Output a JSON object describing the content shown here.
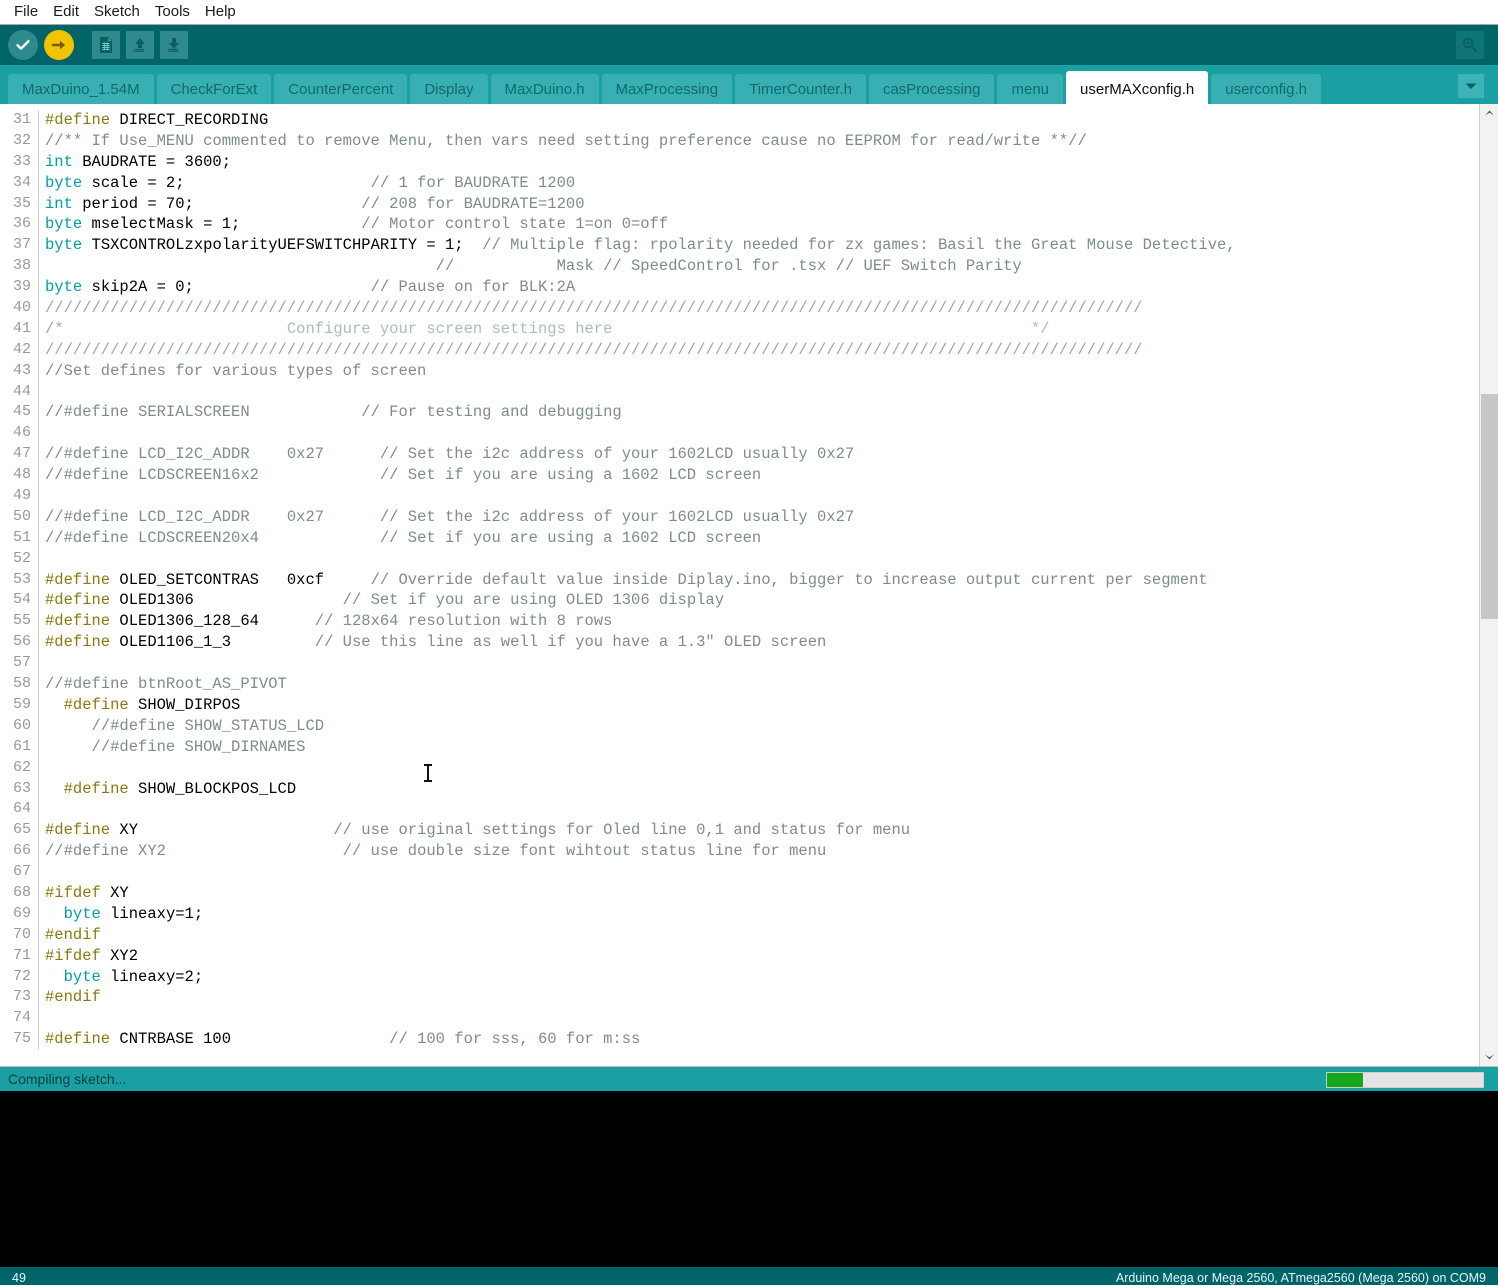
{
  "menubar": {
    "items": [
      "File",
      "Edit",
      "Sketch",
      "Tools",
      "Help"
    ]
  },
  "toolbar": {
    "verify_label": "Verify",
    "upload_label": "Upload",
    "new_label": "New",
    "open_label": "Open",
    "save_label": "Save",
    "serial_monitor_label": "Serial Monitor",
    "colors": {
      "bar": "#006468",
      "verify_bg": "#2f8a8e",
      "upload_bg": "#f2c400"
    }
  },
  "tabs": {
    "items": [
      {
        "label": "MaxDuino_1.54M",
        "active": false
      },
      {
        "label": "CheckForExt",
        "active": false
      },
      {
        "label": "CounterPercent",
        "active": false
      },
      {
        "label": "Display",
        "active": false
      },
      {
        "label": "MaxDuino.h",
        "active": false
      },
      {
        "label": "MaxProcessing",
        "active": false
      },
      {
        "label": "TimerCounter.h",
        "active": false
      },
      {
        "label": "casProcessing",
        "active": false
      },
      {
        "label": "menu",
        "active": false
      },
      {
        "label": "userMAXconfig.h",
        "active": true
      },
      {
        "label": "userconfig.h",
        "active": false
      }
    ],
    "dropdown_icon": "chevron-down-icon",
    "bar_color": "#1a9fa3",
    "tab_color": "#38b0b3"
  },
  "editor": {
    "first_line": 31,
    "lines": [
      {
        "n": 31,
        "parts": [
          {
            "t": "#define ",
            "c": "k-pre"
          },
          {
            "t": "DIRECT_RECORDING",
            "c": ""
          }
        ]
      },
      {
        "n": 32,
        "parts": [
          {
            "t": "//** If Use_MENU commented to remove Menu, then vars need setting preference cause no EEPROM for read/write **//",
            "c": "k-cmt"
          }
        ]
      },
      {
        "n": 33,
        "parts": [
          {
            "t": "int",
            "c": "k-type"
          },
          {
            "t": " BAUDRATE = 3600;",
            "c": ""
          }
        ]
      },
      {
        "n": 34,
        "parts": [
          {
            "t": "byte",
            "c": "k-type"
          },
          {
            "t": " scale = 2;                    ",
            "c": ""
          },
          {
            "t": "// 1 for BAUDRATE 1200",
            "c": "k-cmt"
          }
        ]
      },
      {
        "n": 35,
        "parts": [
          {
            "t": "int",
            "c": "k-type"
          },
          {
            "t": " period = 70;                  ",
            "c": ""
          },
          {
            "t": "// 208 for BAUDRATE=1200",
            "c": "k-cmt"
          }
        ]
      },
      {
        "n": 36,
        "parts": [
          {
            "t": "byte",
            "c": "k-type"
          },
          {
            "t": " mselectMask = 1;             ",
            "c": ""
          },
          {
            "t": "// Motor control state 1=on 0=off",
            "c": "k-cmt"
          }
        ]
      },
      {
        "n": 37,
        "parts": [
          {
            "t": "byte",
            "c": "k-type"
          },
          {
            "t": " TSXCONTROLzxpolarityUEFSWITCHPARITY = 1;  ",
            "c": ""
          },
          {
            "t": "// Multiple flag: rpolarity needed for zx games: Basil the Great Mouse Detective,",
            "c": "k-cmt"
          }
        ]
      },
      {
        "n": 38,
        "parts": [
          {
            "t": "                                          ",
            "c": ""
          },
          {
            "t": "//           Mask // SpeedControl for .tsx // UEF Switch Parity",
            "c": "k-cmt"
          }
        ]
      },
      {
        "n": 39,
        "parts": [
          {
            "t": "byte",
            "c": "k-type"
          },
          {
            "t": " skip2A = 0;                   ",
            "c": ""
          },
          {
            "t": "// Pause on for BLK:2A",
            "c": "k-cmt"
          }
        ]
      },
      {
        "n": 40,
        "parts": [
          {
            "t": "//////////////////////////////////////////////////////////////////////////////////////////////////////////////////////",
            "c": "k-cmt-l"
          }
        ]
      },
      {
        "n": 41,
        "parts": [
          {
            "t": "/*",
            "c": "k-cmt-l"
          },
          {
            "t": "                        Configure your screen settings here                                             ",
            "c": "k-cmt-g"
          },
          {
            "t": "*/",
            "c": "k-cmt-g"
          }
        ]
      },
      {
        "n": 42,
        "parts": [
          {
            "t": "//////////////////////////////////////////////////////////////////////////////////////////////////////////////////////",
            "c": "k-cmt-l"
          }
        ]
      },
      {
        "n": 43,
        "parts": [
          {
            "t": "//Set defines for various types of screen",
            "c": "k-cmt"
          }
        ]
      },
      {
        "n": 44,
        "parts": [
          {
            "t": "",
            "c": ""
          }
        ]
      },
      {
        "n": 45,
        "parts": [
          {
            "t": "//#define SERIALSCREEN            ",
            "c": "k-cmt"
          },
          {
            "t": "// For testing and debugging",
            "c": "k-cmt"
          }
        ]
      },
      {
        "n": 46,
        "parts": [
          {
            "t": "",
            "c": ""
          }
        ]
      },
      {
        "n": 47,
        "parts": [
          {
            "t": "//#define LCD_I2C_ADDR    0x27      ",
            "c": "k-cmt"
          },
          {
            "t": "// Set the i2c address of your 1602LCD usually 0x27",
            "c": "k-cmt"
          }
        ]
      },
      {
        "n": 48,
        "parts": [
          {
            "t": "//#define LCDSCREEN16x2             ",
            "c": "k-cmt"
          },
          {
            "t": "// Set if you are using a 1602 LCD screen",
            "c": "k-cmt"
          }
        ]
      },
      {
        "n": 49,
        "parts": [
          {
            "t": "",
            "c": ""
          }
        ]
      },
      {
        "n": 50,
        "parts": [
          {
            "t": "//#define LCD_I2C_ADDR    0x27      ",
            "c": "k-cmt"
          },
          {
            "t": "// Set the i2c address of your 1602LCD usually 0x27",
            "c": "k-cmt"
          }
        ]
      },
      {
        "n": 51,
        "parts": [
          {
            "t": "//#define LCDSCREEN20x4             ",
            "c": "k-cmt"
          },
          {
            "t": "// Set if you are using a 1602 LCD screen",
            "c": "k-cmt"
          }
        ]
      },
      {
        "n": 52,
        "parts": [
          {
            "t": "",
            "c": ""
          }
        ]
      },
      {
        "n": 53,
        "parts": [
          {
            "t": "#define ",
            "c": "k-pre"
          },
          {
            "t": "OLED_SETCONTRAS   0xcf     ",
            "c": ""
          },
          {
            "t": "// Override default value inside Diplay.ino, bigger to increase output current per segment",
            "c": "k-cmt"
          }
        ]
      },
      {
        "n": 54,
        "parts": [
          {
            "t": "#define ",
            "c": "k-pre"
          },
          {
            "t": "OLED1306                ",
            "c": ""
          },
          {
            "t": "// Set if you are using OLED 1306 display",
            "c": "k-cmt"
          }
        ]
      },
      {
        "n": 55,
        "parts": [
          {
            "t": "#define ",
            "c": "k-pre"
          },
          {
            "t": "OLED1306_128_64      ",
            "c": ""
          },
          {
            "t": "// 128x64 resolution with 8 rows",
            "c": "k-cmt"
          }
        ]
      },
      {
        "n": 56,
        "parts": [
          {
            "t": "#define ",
            "c": "k-pre"
          },
          {
            "t": "OLED1106_1_3         ",
            "c": ""
          },
          {
            "t": "// Use this line as well if you have a 1.3\" OLED screen",
            "c": "k-cmt"
          }
        ]
      },
      {
        "n": 57,
        "parts": [
          {
            "t": "",
            "c": ""
          }
        ]
      },
      {
        "n": 58,
        "parts": [
          {
            "t": "//#define btnRoot_AS_PIVOT",
            "c": "k-cmt"
          }
        ]
      },
      {
        "n": 59,
        "parts": [
          {
            "t": "  ",
            "c": ""
          },
          {
            "t": "#define ",
            "c": "k-pre"
          },
          {
            "t": "SHOW_DIRPOS",
            "c": ""
          }
        ]
      },
      {
        "n": 60,
        "parts": [
          {
            "t": "     ",
            "c": ""
          },
          {
            "t": "//#define SHOW_STATUS_LCD",
            "c": "k-cmt"
          }
        ]
      },
      {
        "n": 61,
        "parts": [
          {
            "t": "     ",
            "c": ""
          },
          {
            "t": "//#define SHOW_DIRNAMES",
            "c": "k-cmt"
          }
        ]
      },
      {
        "n": 62,
        "parts": [
          {
            "t": "",
            "c": ""
          }
        ]
      },
      {
        "n": 63,
        "parts": [
          {
            "t": "  ",
            "c": ""
          },
          {
            "t": "#define ",
            "c": "k-pre"
          },
          {
            "t": "SHOW_BLOCKPOS_LCD",
            "c": ""
          }
        ]
      },
      {
        "n": 64,
        "parts": [
          {
            "t": "",
            "c": ""
          }
        ]
      },
      {
        "n": 65,
        "parts": [
          {
            "t": "#define ",
            "c": "k-pre"
          },
          {
            "t": "XY                     ",
            "c": ""
          },
          {
            "t": "// use original settings for Oled line 0,1 and status for menu",
            "c": "k-cmt"
          }
        ]
      },
      {
        "n": 66,
        "parts": [
          {
            "t": "//#define XY2                   ",
            "c": "k-cmt"
          },
          {
            "t": "// use double size font wihtout status line for menu",
            "c": "k-cmt"
          }
        ]
      },
      {
        "n": 67,
        "parts": [
          {
            "t": "",
            "c": ""
          }
        ]
      },
      {
        "n": 68,
        "parts": [
          {
            "t": "#ifdef ",
            "c": "k-pre"
          },
          {
            "t": "XY",
            "c": ""
          }
        ]
      },
      {
        "n": 69,
        "parts": [
          {
            "t": "  ",
            "c": ""
          },
          {
            "t": "byte",
            "c": "k-type"
          },
          {
            "t": " lineaxy=1;",
            "c": ""
          }
        ]
      },
      {
        "n": 70,
        "parts": [
          {
            "t": "#endif",
            "c": "k-pre"
          }
        ]
      },
      {
        "n": 71,
        "parts": [
          {
            "t": "#ifdef ",
            "c": "k-pre"
          },
          {
            "t": "XY2",
            "c": ""
          }
        ]
      },
      {
        "n": 72,
        "parts": [
          {
            "t": "  ",
            "c": ""
          },
          {
            "t": "byte",
            "c": "k-type"
          },
          {
            "t": " lineaxy=2;",
            "c": ""
          }
        ]
      },
      {
        "n": 73,
        "parts": [
          {
            "t": "#endif",
            "c": "k-pre"
          }
        ]
      },
      {
        "n": 74,
        "parts": [
          {
            "t": "",
            "c": ""
          }
        ]
      },
      {
        "n": 75,
        "parts": [
          {
            "t": "#define ",
            "c": "k-pre"
          },
          {
            "t": "CNTRBASE 100                 ",
            "c": ""
          },
          {
            "t": "// 100 for sss, 60 for m:ss",
            "c": "k-cmt"
          }
        ]
      }
    ]
  },
  "status": {
    "message": "Compiling sketch...",
    "progress_percent": 23,
    "progress_color": "#15a81c"
  },
  "bottombar": {
    "cursor_line": "49",
    "board_info": "Arduino Mega or Mega 2560, ATmega2560 (Mega 2560) on COM9"
  }
}
